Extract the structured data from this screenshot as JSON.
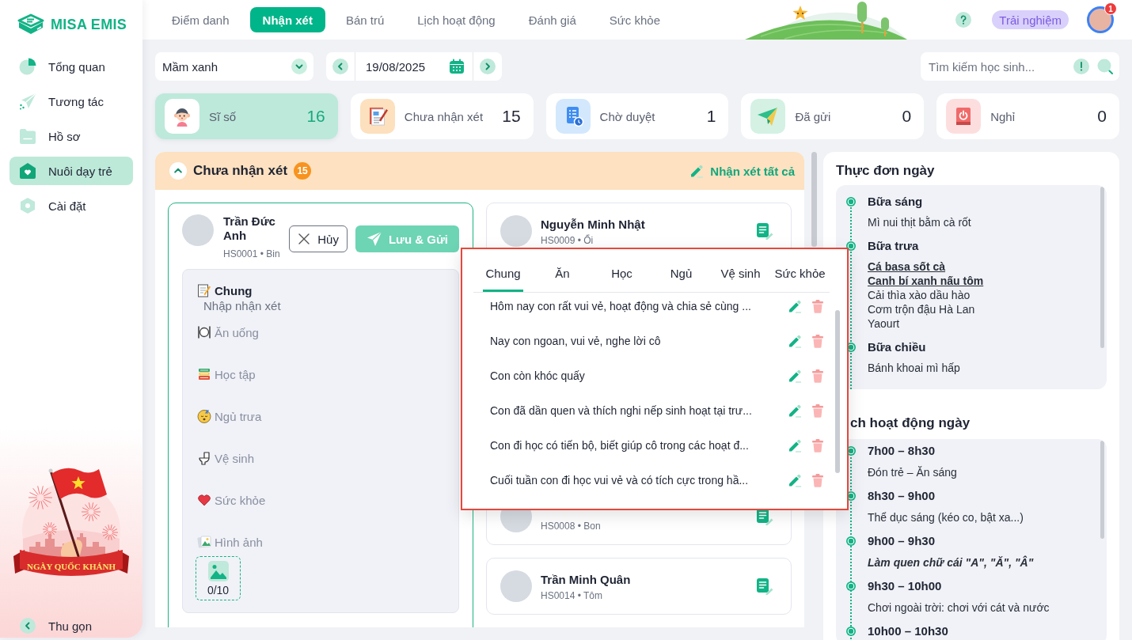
{
  "sidebar": {
    "logo": "MISA EMIS",
    "items": [
      {
        "kind": "overview",
        "label": "Tổng quan",
        "selected": false
      },
      {
        "kind": "interaction",
        "label": "Tương tác",
        "selected": false
      },
      {
        "kind": "records",
        "label": "Hồ sơ",
        "selected": false
      },
      {
        "kind": "nurture",
        "label": "Nuôi dạy trẻ",
        "selected": true
      },
      {
        "kind": "settings",
        "label": "Cài đặt",
        "selected": false
      }
    ],
    "banner": "NGÀY QUỐC KHÁNH",
    "collapse": "Thu gọn"
  },
  "topbar": {
    "tabs": [
      {
        "label": "Điểm danh",
        "selected": false
      },
      {
        "label": "Nhận xét",
        "selected": true
      },
      {
        "label": "Bán trú",
        "selected": false
      },
      {
        "label": "Lịch hoạt động",
        "selected": false
      },
      {
        "label": "Đánh giá",
        "selected": false
      },
      {
        "label": "Sức khỏe",
        "selected": false
      }
    ],
    "trial_button": "Trải nghiệm",
    "notification_count": "1"
  },
  "filters": {
    "class_select": "Mầm xanh",
    "date": "19/08/2025",
    "search": {
      "placeholder": "Tìm kiếm học sinh..."
    }
  },
  "stats": [
    {
      "kind": "total",
      "label": "Sĩ số",
      "value": "16",
      "selected": true
    },
    {
      "kind": "pending",
      "label": "Chưa nhận xét",
      "value": "15",
      "selected": false
    },
    {
      "kind": "review",
      "label": "Chờ duyệt",
      "value": "1",
      "selected": false
    },
    {
      "kind": "sent",
      "label": "Đã gửi",
      "value": "0",
      "selected": false
    },
    {
      "kind": "absent",
      "label": "Nghỉ",
      "value": "0",
      "selected": false
    }
  ],
  "comments_panel": {
    "title": "Chưa nhận xét",
    "count": "15",
    "expanded": true,
    "action": "Nhận xét tất cả",
    "editor": {
      "name": "Trần Đức Anh",
      "code": "HS0001 • Bin",
      "cancel": "Hủy",
      "save": "Lưu & Gửi",
      "sections": [
        {
          "kind": "general",
          "label": "Chung",
          "selected": true,
          "placeholder": "Nhập nhận xét"
        },
        {
          "kind": "meal",
          "label": "Ăn uống",
          "selected": false
        },
        {
          "kind": "study",
          "label": "Học tập",
          "selected": false
        },
        {
          "kind": "nap",
          "label": "Ngủ trưa",
          "selected": false
        },
        {
          "kind": "hygiene",
          "label": "Vệ sinh",
          "selected": false
        },
        {
          "kind": "health",
          "label": "Sức khỏe",
          "selected": false
        },
        {
          "kind": "photos",
          "label": "Hình ảnh",
          "selected": false
        }
      ],
      "photo_count": "0/10"
    },
    "students": [
      {
        "name": "Nguyễn Minh Nhật",
        "code": "HS0009 • Ổi"
      },
      {
        "code": "HS0008 • Bon"
      },
      {
        "name": "Trần Minh Quân",
        "code": "HS0014 • Tôm"
      }
    ]
  },
  "suggestion_popup": {
    "tabs": [
      {
        "label": "Chung",
        "selected": true
      },
      {
        "label": "Ăn",
        "selected": false
      },
      {
        "label": "Học",
        "selected": false
      },
      {
        "label": "Ngủ",
        "selected": false
      },
      {
        "label": "Vệ sinh",
        "selected": false
      },
      {
        "label": "Sức khỏe",
        "selected": false
      }
    ],
    "items": [
      "Hôm nay con rất vui vẻ, hoạt động và chia sẻ cùng ...",
      "Nay con ngoan, vui vẻ, nghe lời cô",
      "Con còn khóc quấy",
      "Con đã dần quen và thích nghi nếp sinh hoạt tại trư...",
      "Con đi học có tiến bộ, biết giúp cô trong các hoạt đ...",
      "Cuối tuần con đi học vui vẻ và có tích cực trong hầ..."
    ]
  },
  "menu": {
    "title": "Thực đơn ngày",
    "meals": [
      {
        "name": "Bữa sáng",
        "dishes": [
          {
            "text": "Mì nui thịt bằm cà rốt",
            "highlighted": false
          }
        ]
      },
      {
        "name": "Bữa trưa",
        "dishes": [
          {
            "text": "Cá basa sốt cà",
            "highlighted": true
          },
          {
            "text": "Canh bí xanh nấu tôm",
            "highlighted": true
          },
          {
            "text": "Cải thìa xào dầu hào",
            "highlighted": false
          },
          {
            "text": "Cơm trộn đậu Hà Lan",
            "highlighted": false
          },
          {
            "text": "Yaourt",
            "highlighted": false
          }
        ]
      },
      {
        "name": "Bữa chiều",
        "dishes": [
          {
            "text": "Bánh khoai mì hấp",
            "highlighted": false
          }
        ]
      }
    ]
  },
  "activities": {
    "title": "ch hoạt động ngày",
    "items": [
      {
        "time": "7h00 – 8h30",
        "description": "Đón trẻ – Ăn sáng",
        "highlighted": false
      },
      {
        "time": "8h30 – 9h00",
        "description": "Thể dục sáng (kéo co, bật xa...)",
        "highlighted": false
      },
      {
        "time": "9h00 – 9h30",
        "description": "Làm quen chữ cái \"A\", \"Ă\", \"Â\"",
        "highlighted": true
      },
      {
        "time": "9h30 – 10h00",
        "description": "Chơi ngoài trời: chơi với cát và nước",
        "highlighted": false
      },
      {
        "time": "10h00 – 10h30"
      }
    ]
  }
}
